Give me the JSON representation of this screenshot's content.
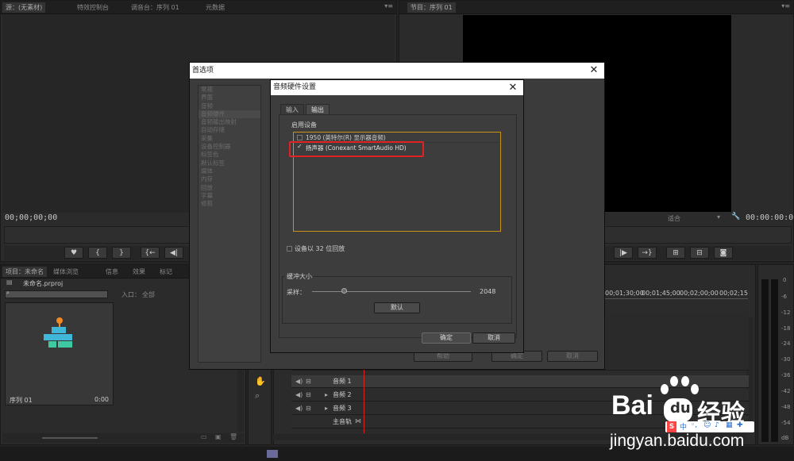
{
  "source_panel": {
    "tabs": [
      "源：(无素材)",
      "特效控制台",
      "调音台：序列 01",
      "元数据"
    ],
    "timecode": "00;00;00;00"
  },
  "program_panel": {
    "tab": "节目：序列 01",
    "timecode": "00:00:00:00",
    "fit_label": "适合"
  },
  "project_panel": {
    "tabs": [
      "项目：未命名",
      "媒体浏览",
      "信息",
      "效果",
      "标记"
    ],
    "project_file": "未命名.prproj",
    "entry_label": "入口：",
    "entry_value": "全部",
    "sequence_name": "序列 01",
    "sequence_duration": "0:00"
  },
  "timeline": {
    "ruler": [
      "00;01;30;00",
      "00;01;45;00",
      "00;02;00;00",
      "00;02;15"
    ],
    "tracks": [
      "音频 1",
      "音频 2",
      "音频 3"
    ],
    "master_track": "主音轨"
  },
  "meter": {
    "labels": [
      "0",
      "-6",
      "-12",
      "-18",
      "-24",
      "-30",
      "-36",
      "-42",
      "-48",
      "-54",
      "dB"
    ]
  },
  "preferences_dialog": {
    "title": "首选项",
    "close": "✕",
    "categories": [
      "常规",
      "界面",
      "音频",
      "音频硬件",
      "音频输出映射",
      "自动存储",
      "采集",
      "设备控制器",
      "标签色",
      "默认标签",
      "媒体",
      "内存",
      "回放",
      "字幕",
      "修剪"
    ],
    "help_button": "帮助",
    "ok_button": "确定",
    "cancel_button": "取消"
  },
  "audio_hw_dialog": {
    "title": "音频硬件设置",
    "close": "✕",
    "tabs": [
      "输入",
      "输出"
    ],
    "active_tab": "输出",
    "group_label": "启用设备",
    "devices": [
      {
        "label": "1950 (英特尔(R) 显示器音频)",
        "checked": false
      },
      {
        "label": "扬声器 (Conexant SmartAudio HD)",
        "checked": true
      }
    ],
    "bit32_label": "设备以 32 位回放",
    "buffer_group": "缓冲大小",
    "sample_label": "采样：",
    "sample_value": "2048",
    "sample_fraction": 0.2,
    "default_button": "默认",
    "ok_button": "确定",
    "cancel_button": "取消"
  },
  "watermark": {
    "brand_latin": "Bai",
    "brand_cn": "经验",
    "url": "jingyan.baidu.com"
  },
  "colors": {
    "highlight_red": "#e12222",
    "device_box": "#c8921b",
    "accent_orange": "#f08a24",
    "accent_cyan": "#40b6d8",
    "accent_green": "#3fc9a2"
  }
}
